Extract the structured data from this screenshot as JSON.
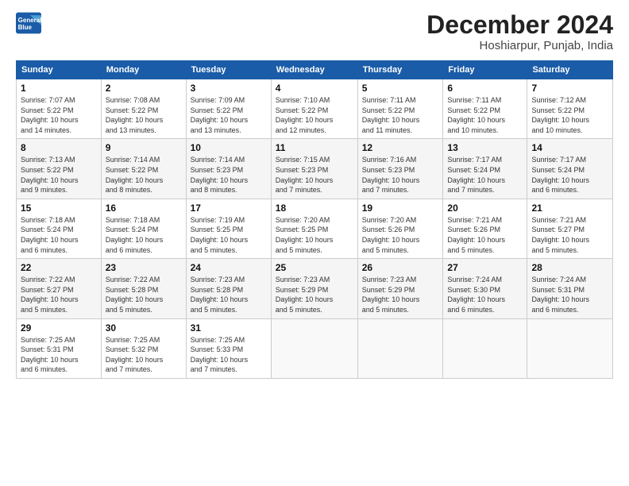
{
  "header": {
    "logo_line1": "General",
    "logo_line2": "Blue",
    "month": "December 2024",
    "location": "Hoshiarpur, Punjab, India"
  },
  "days_of_week": [
    "Sunday",
    "Monday",
    "Tuesday",
    "Wednesday",
    "Thursday",
    "Friday",
    "Saturday"
  ],
  "weeks": [
    [
      {
        "day": "1",
        "info": "Sunrise: 7:07 AM\nSunset: 5:22 PM\nDaylight: 10 hours\nand 14 minutes."
      },
      {
        "day": "2",
        "info": "Sunrise: 7:08 AM\nSunset: 5:22 PM\nDaylight: 10 hours\nand 13 minutes."
      },
      {
        "day": "3",
        "info": "Sunrise: 7:09 AM\nSunset: 5:22 PM\nDaylight: 10 hours\nand 13 minutes."
      },
      {
        "day": "4",
        "info": "Sunrise: 7:10 AM\nSunset: 5:22 PM\nDaylight: 10 hours\nand 12 minutes."
      },
      {
        "day": "5",
        "info": "Sunrise: 7:11 AM\nSunset: 5:22 PM\nDaylight: 10 hours\nand 11 minutes."
      },
      {
        "day": "6",
        "info": "Sunrise: 7:11 AM\nSunset: 5:22 PM\nDaylight: 10 hours\nand 10 minutes."
      },
      {
        "day": "7",
        "info": "Sunrise: 7:12 AM\nSunset: 5:22 PM\nDaylight: 10 hours\nand 10 minutes."
      }
    ],
    [
      {
        "day": "8",
        "info": "Sunrise: 7:13 AM\nSunset: 5:22 PM\nDaylight: 10 hours\nand 9 minutes."
      },
      {
        "day": "9",
        "info": "Sunrise: 7:14 AM\nSunset: 5:22 PM\nDaylight: 10 hours\nand 8 minutes."
      },
      {
        "day": "10",
        "info": "Sunrise: 7:14 AM\nSunset: 5:23 PM\nDaylight: 10 hours\nand 8 minutes."
      },
      {
        "day": "11",
        "info": "Sunrise: 7:15 AM\nSunset: 5:23 PM\nDaylight: 10 hours\nand 7 minutes."
      },
      {
        "day": "12",
        "info": "Sunrise: 7:16 AM\nSunset: 5:23 PM\nDaylight: 10 hours\nand 7 minutes."
      },
      {
        "day": "13",
        "info": "Sunrise: 7:17 AM\nSunset: 5:24 PM\nDaylight: 10 hours\nand 7 minutes."
      },
      {
        "day": "14",
        "info": "Sunrise: 7:17 AM\nSunset: 5:24 PM\nDaylight: 10 hours\nand 6 minutes."
      }
    ],
    [
      {
        "day": "15",
        "info": "Sunrise: 7:18 AM\nSunset: 5:24 PM\nDaylight: 10 hours\nand 6 minutes."
      },
      {
        "day": "16",
        "info": "Sunrise: 7:18 AM\nSunset: 5:24 PM\nDaylight: 10 hours\nand 6 minutes."
      },
      {
        "day": "17",
        "info": "Sunrise: 7:19 AM\nSunset: 5:25 PM\nDaylight: 10 hours\nand 5 minutes."
      },
      {
        "day": "18",
        "info": "Sunrise: 7:20 AM\nSunset: 5:25 PM\nDaylight: 10 hours\nand 5 minutes."
      },
      {
        "day": "19",
        "info": "Sunrise: 7:20 AM\nSunset: 5:26 PM\nDaylight: 10 hours\nand 5 minutes."
      },
      {
        "day": "20",
        "info": "Sunrise: 7:21 AM\nSunset: 5:26 PM\nDaylight: 10 hours\nand 5 minutes."
      },
      {
        "day": "21",
        "info": "Sunrise: 7:21 AM\nSunset: 5:27 PM\nDaylight: 10 hours\nand 5 minutes."
      }
    ],
    [
      {
        "day": "22",
        "info": "Sunrise: 7:22 AM\nSunset: 5:27 PM\nDaylight: 10 hours\nand 5 minutes."
      },
      {
        "day": "23",
        "info": "Sunrise: 7:22 AM\nSunset: 5:28 PM\nDaylight: 10 hours\nand 5 minutes."
      },
      {
        "day": "24",
        "info": "Sunrise: 7:23 AM\nSunset: 5:28 PM\nDaylight: 10 hours\nand 5 minutes."
      },
      {
        "day": "25",
        "info": "Sunrise: 7:23 AM\nSunset: 5:29 PM\nDaylight: 10 hours\nand 5 minutes."
      },
      {
        "day": "26",
        "info": "Sunrise: 7:23 AM\nSunset: 5:29 PM\nDaylight: 10 hours\nand 5 minutes."
      },
      {
        "day": "27",
        "info": "Sunrise: 7:24 AM\nSunset: 5:30 PM\nDaylight: 10 hours\nand 6 minutes."
      },
      {
        "day": "28",
        "info": "Sunrise: 7:24 AM\nSunset: 5:31 PM\nDaylight: 10 hours\nand 6 minutes."
      }
    ],
    [
      {
        "day": "29",
        "info": "Sunrise: 7:25 AM\nSunset: 5:31 PM\nDaylight: 10 hours\nand 6 minutes."
      },
      {
        "day": "30",
        "info": "Sunrise: 7:25 AM\nSunset: 5:32 PM\nDaylight: 10 hours\nand 7 minutes."
      },
      {
        "day": "31",
        "info": "Sunrise: 7:25 AM\nSunset: 5:33 PM\nDaylight: 10 hours\nand 7 minutes."
      },
      {
        "day": "",
        "info": ""
      },
      {
        "day": "",
        "info": ""
      },
      {
        "day": "",
        "info": ""
      },
      {
        "day": "",
        "info": ""
      }
    ]
  ]
}
